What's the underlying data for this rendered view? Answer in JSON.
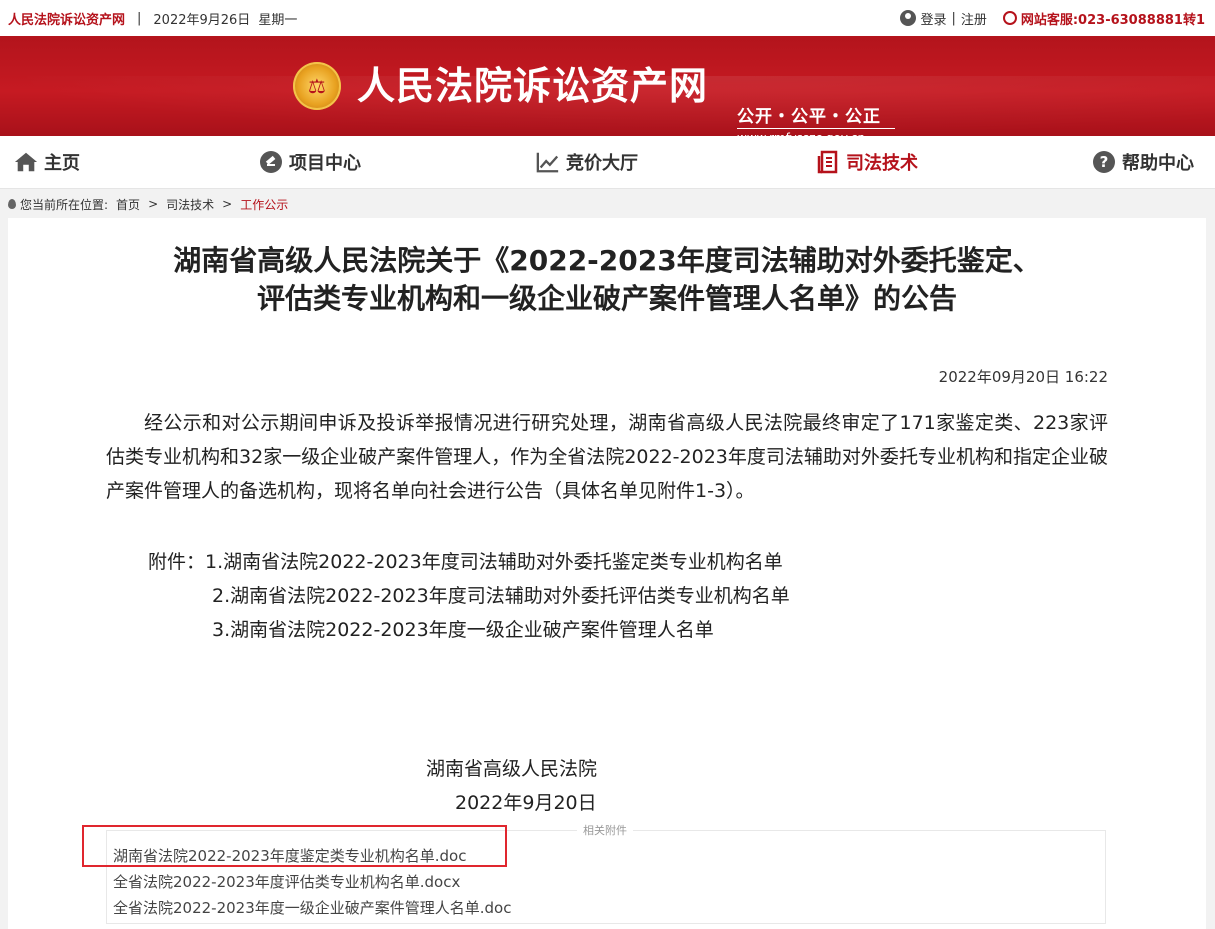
{
  "topbar": {
    "site_name": "人民法院诉讼资产网",
    "separator": "|",
    "date": "2022年9月26日",
    "weekday": "星期一",
    "login": "登录",
    "divider": "|",
    "register": "注册",
    "hotline": "网站客服:023-63088881转1"
  },
  "banner": {
    "title": "人民法院诉讼资产网",
    "slogan": "公开・公平・公正",
    "url": "www.rmfysszc.gov.cn"
  },
  "nav": {
    "items": [
      {
        "label": "主页",
        "icon": "home-icon"
      },
      {
        "label": "项目中心",
        "icon": "gavel-icon"
      },
      {
        "label": "竞价大厅",
        "icon": "trend-chart-icon"
      },
      {
        "label": "司法技术",
        "icon": "document-icon"
      },
      {
        "label": "帮助中心",
        "icon": "help-icon"
      }
    ],
    "active": "司法技术"
  },
  "breadcrumb": {
    "prefix": "您当前所在位置:",
    "items": [
      "首页",
      "司法技术",
      "工作公示"
    ],
    "gt": ">"
  },
  "article": {
    "title_line1": "湖南省高级人民法院关于《2022-2023年度司法辅助对外委托鉴定、",
    "title_line2": "评估类专业机构和一级企业破产案件管理人名单》的公告",
    "publish_time": "2022年09月20日 16:22",
    "body": "经公示和对公示期间申诉及投诉举报情况进行研究处理，湖南省高级人民法院最终审定了171家鉴定类、223家评估类专业机构和32家一级企业破产案件管理人，作为全省法院2022-2023年度司法辅助对外委托专业机构和指定企业破产案件管理人的备选机构，现将名单向社会进行公告（具体名单见附件1-3）。",
    "attachments_label": "附件：",
    "attachments": [
      "1.湖南省法院2022-2023年度司法辅助对外委托鉴定类专业机构名单",
      "2.湖南省法院2022-2023年度司法辅助对外委托评估类专业机构名单",
      "3.湖南省法院2022-2023年度一级企业破产案件管理人名单"
    ],
    "signature_org": "湖南省高级人民法院",
    "signature_date": "2022年9月20日"
  },
  "files": {
    "legend": "相关附件",
    "items": [
      "湖南省法院2022-2023年度鉴定类专业机构名单.doc",
      "全省法院2022-2023年度评估类专业机构名单.docx",
      "全省法院2022-2023年度一级企业破产案件管理人名单.doc"
    ]
  },
  "colors": {
    "brand_red": "#b5121b",
    "highlight_red": "#e0262e"
  }
}
